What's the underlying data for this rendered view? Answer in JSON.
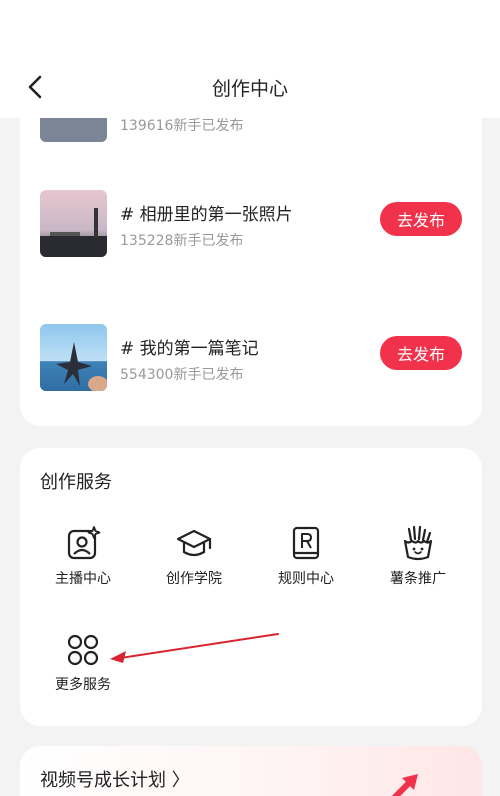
{
  "header": {
    "title": "创作中心"
  },
  "tasks": [
    {
      "title": "",
      "sub": "139616新手已发布"
    },
    {
      "title": "# 相册里的第一张照片",
      "sub": "135228新手已发布",
      "button": "去发布"
    },
    {
      "title": "# 我的第一篇笔记",
      "sub": "554300新手已发布",
      "button": "去发布"
    }
  ],
  "services": {
    "title": "创作服务",
    "items": [
      {
        "label": "主播中心",
        "icon": "anchor-center-icon"
      },
      {
        "label": "创作学院",
        "icon": "graduation-cap-icon"
      },
      {
        "label": "规则中心",
        "icon": "rule-book-icon"
      },
      {
        "label": "薯条推广",
        "icon": "fries-icon"
      },
      {
        "label": "更多服务",
        "icon": "grid-circles-icon"
      }
    ]
  },
  "growth": {
    "title": "视频号成长计划 〉"
  },
  "colors": {
    "accent": "#f2314a",
    "annotation": "#d9232e"
  }
}
